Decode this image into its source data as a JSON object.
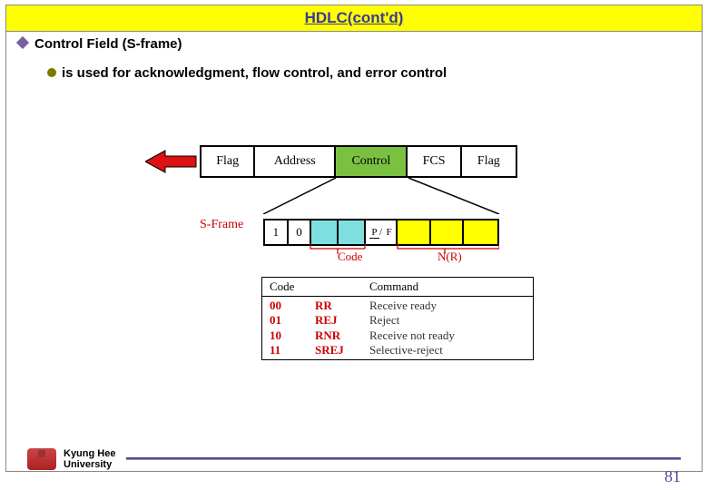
{
  "title": "HDLC(cont'd)",
  "bullet1": "Control Field (S-frame)",
  "bullet2": "is used for acknowledgment, flow control, and error control",
  "frame": {
    "c1": "Flag",
    "c2": "Address",
    "c3": "Control",
    "c4": "FCS",
    "c5": "Flag"
  },
  "sframe_label": "S-Frame",
  "control_bits": {
    "b1": "1",
    "b2": "0",
    "pf": "P/F"
  },
  "code_label": "Code",
  "nr_label": "N(R)",
  "code_table": {
    "h1": "Code",
    "h2": "Command",
    "rows": [
      {
        "code": "00",
        "abbr": "RR",
        "cmd": "Receive ready"
      },
      {
        "code": "01",
        "abbr": "REJ",
        "cmd": "Reject"
      },
      {
        "code": "10",
        "abbr": "RNR",
        "cmd": "Receive not ready"
      },
      {
        "code": "11",
        "abbr": "SREJ",
        "cmd": "Selective-reject"
      }
    ]
  },
  "footer": {
    "uni1": "Kyung Hee",
    "uni2": "University",
    "page": "81"
  }
}
